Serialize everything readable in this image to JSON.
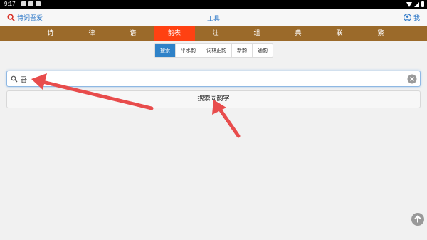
{
  "status": {
    "time": "9:17"
  },
  "app": {
    "brand": "诗词吾爱",
    "title": "工具",
    "me": "我"
  },
  "nav": {
    "items": [
      "诗",
      "律",
      "谱",
      "韵表",
      "注",
      "组",
      "典",
      "联",
      "繁"
    ],
    "active_index": 3
  },
  "subtabs": {
    "items": [
      "搜索",
      "平水韵",
      "词林正韵",
      "新韵",
      "通韵"
    ],
    "active_index": 0
  },
  "search": {
    "value": "吾",
    "button_label": "搜索同韵字"
  },
  "colors": {
    "accent": "#2d78c8",
    "nav_bg": "#9b6a2a",
    "nav_active": "#ff4112",
    "arrow": "#e84c4c"
  },
  "icons": [
    "search-icon",
    "user-icon",
    "clear-icon",
    "arrow-up-icon"
  ]
}
